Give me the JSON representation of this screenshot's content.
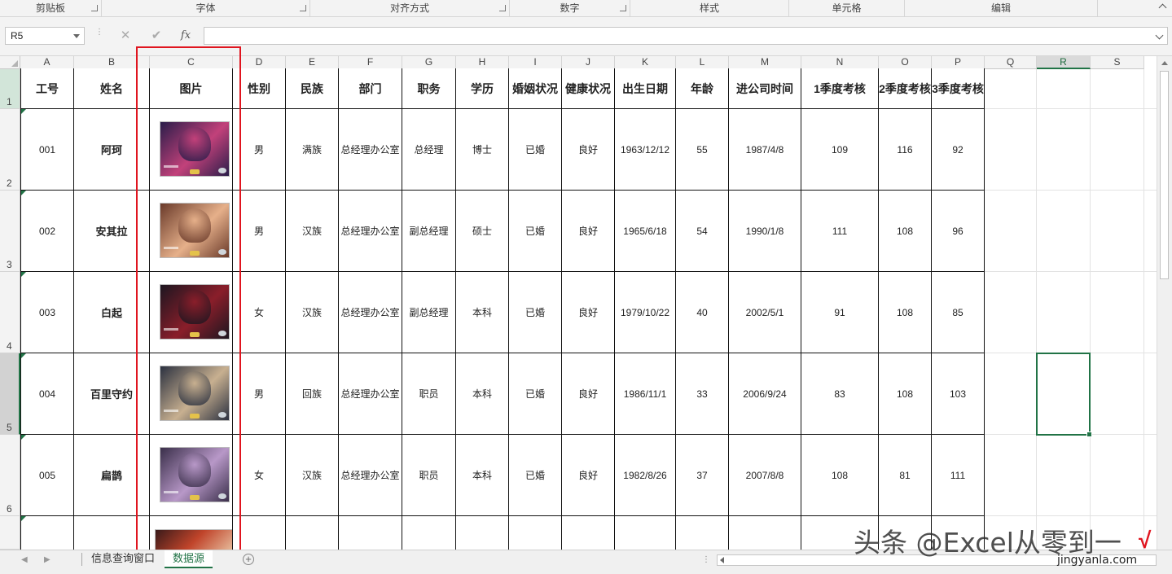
{
  "ribbon": {
    "groups": [
      {
        "label": "剪贴板",
        "launcher": true
      },
      {
        "label": "字体",
        "launcher": true
      },
      {
        "label": "对齐方式",
        "launcher": true
      },
      {
        "label": "数字",
        "launcher": true
      },
      {
        "label": "样式",
        "launcher": false
      },
      {
        "label": "单元格",
        "launcher": false
      },
      {
        "label": "编辑",
        "launcher": false
      }
    ]
  },
  "formula_bar": {
    "name_box": "R5",
    "cancel_icon": "✕",
    "enter_icon": "✔",
    "fx_label": "fx",
    "formula_value": ""
  },
  "columns": [
    "A",
    "B",
    "C",
    "D",
    "E",
    "F",
    "G",
    "H",
    "I",
    "J",
    "K",
    "L",
    "M",
    "N",
    "O",
    "P",
    "Q",
    "R",
    "S"
  ],
  "selected_column": "R",
  "rows": [
    "1",
    "2",
    "3",
    "4",
    "5",
    "6"
  ],
  "selected_row": "5",
  "table": {
    "headers": [
      "工号",
      "姓名",
      "图片",
      "性别",
      "民族",
      "部门",
      "职务",
      "学历",
      "婚姻状况",
      "健康状况",
      "出生日期",
      "年龄",
      "进公司时间",
      "1季度考核",
      "2季度考核",
      "3季度考核"
    ],
    "records": [
      {
        "id": "001",
        "name": "阿珂",
        "gender": "男",
        "ethnic": "满族",
        "dept": "总经理办公室",
        "title": "总经理",
        "edu": "博士",
        "marital": "已婚",
        "health": "良好",
        "birth": "1963/12/12",
        "age": "55",
        "join": "1987/4/8",
        "q1": "109",
        "q2": "116",
        "q3": "92"
      },
      {
        "id": "002",
        "name": "安其拉",
        "gender": "男",
        "ethnic": "汉族",
        "dept": "总经理办公室",
        "title": "副总经理",
        "edu": "硕士",
        "marital": "已婚",
        "health": "良好",
        "birth": "1965/6/18",
        "age": "54",
        "join": "1990/1/8",
        "q1": "111",
        "q2": "108",
        "q3": "96"
      },
      {
        "id": "003",
        "name": "白起",
        "gender": "女",
        "ethnic": "汉族",
        "dept": "总经理办公室",
        "title": "副总经理",
        "edu": "本科",
        "marital": "已婚",
        "health": "良好",
        "birth": "1979/10/22",
        "age": "40",
        "join": "2002/5/1",
        "q1": "91",
        "q2": "108",
        "q3": "85"
      },
      {
        "id": "004",
        "name": "百里守约",
        "gender": "男",
        "ethnic": "回族",
        "dept": "总经理办公室",
        "title": "职员",
        "edu": "本科",
        "marital": "已婚",
        "health": "良好",
        "birth": "1986/11/1",
        "age": "33",
        "join": "2006/9/24",
        "q1": "83",
        "q2": "108",
        "q3": "103"
      },
      {
        "id": "005",
        "name": "扁鹊",
        "gender": "女",
        "ethnic": "汉族",
        "dept": "总经理办公室",
        "title": "职员",
        "edu": "本科",
        "marital": "已婚",
        "health": "良好",
        "birth": "1982/8/26",
        "age": "37",
        "join": "2007/8/8",
        "q1": "108",
        "q2": "81",
        "q3": "111"
      }
    ]
  },
  "sheet_tabs": [
    {
      "label": "信息查询窗口",
      "active": false
    },
    {
      "label": "数据源",
      "active": true
    }
  ],
  "watermark": {
    "line1": "头条 @Excel从零到一",
    "line2": "jingyanla.com"
  },
  "colors": {
    "accent": "#217346",
    "highlight_box": "#e0151f"
  }
}
